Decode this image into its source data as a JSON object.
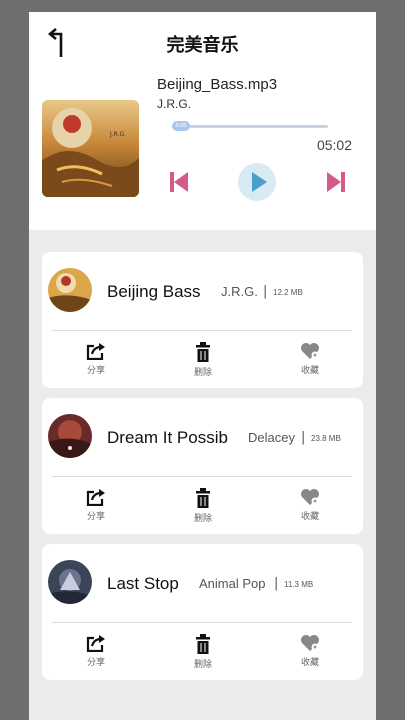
{
  "header": {
    "title": "完美音乐",
    "back_icon": "back-arrow-icon"
  },
  "now_playing": {
    "file_name": "Beijing_Bass.mp3",
    "artist": "J.R.G.",
    "duration": "05:02",
    "progress_label": "0:00",
    "progress": 0.05,
    "cover_icon": "album-cover",
    "controls": {
      "prev_icon": "skip-previous-icon",
      "play_icon": "play-icon",
      "next_icon": "skip-next-icon"
    },
    "colors": {
      "controls": "#d35b8a",
      "play": "#4a9fc8",
      "play_bg": "#d8eaf3"
    }
  },
  "songs": [
    {
      "name": "Beijing Bass",
      "artist": "J.R.G.",
      "separator": "|",
      "size": "12.2 MB",
      "actions": [
        {
          "label": "分享",
          "icon": "share-icon"
        },
        {
          "label": "删除",
          "icon": "trash-icon"
        },
        {
          "label": "收藏",
          "icon": "heart-icon"
        }
      ]
    },
    {
      "name": "Dream It Possib",
      "artist": "Delacey",
      "separator": "|",
      "size": "23.8 MB",
      "actions": [
        {
          "label": "分享",
          "icon": "share-icon"
        },
        {
          "label": "删除",
          "icon": "trash-icon"
        },
        {
          "label": "收藏",
          "icon": "heart-icon"
        }
      ]
    },
    {
      "name": "Last Stop",
      "artist": "Animal Pop",
      "separator": "|",
      "size": "11.3 MB",
      "actions": [
        {
          "label": "分享",
          "icon": "share-icon"
        },
        {
          "label": "删除",
          "icon": "trash-icon"
        },
        {
          "label": "收藏",
          "icon": "heart-icon"
        }
      ]
    }
  ]
}
